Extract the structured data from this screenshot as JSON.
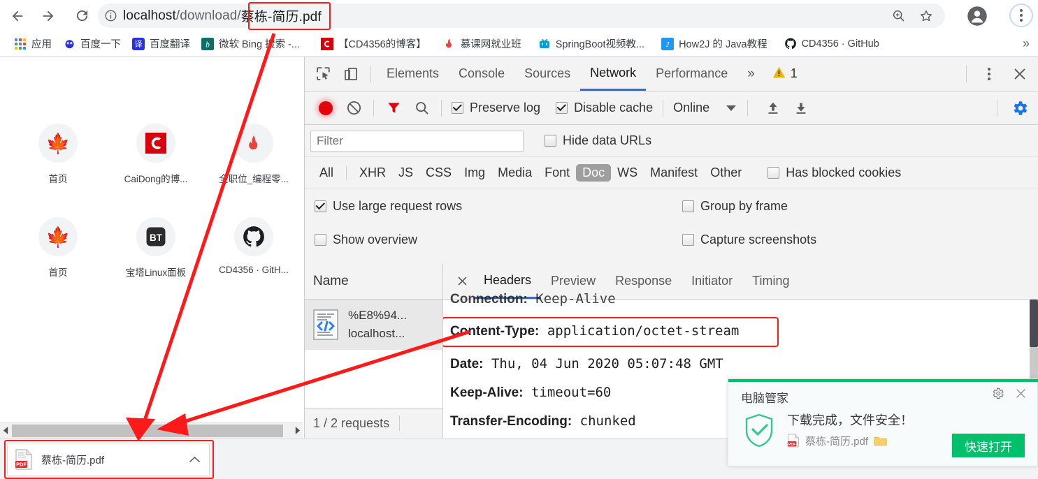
{
  "browser": {
    "nav": {
      "back": "back-arrow",
      "forward": "forward-arrow",
      "reload": "reload"
    },
    "omnibox": {
      "info_icon": "info-circle-icon",
      "url_host": "localhost",
      "url_path": "/download/",
      "url_file": "蔡栋-简历.pdf",
      "zoom_icon": "zoom-in-icon",
      "bookmark_icon": "star-icon"
    },
    "profile_icon": "account-avatar-icon",
    "menu_icon": "three-dot-menu-icon"
  },
  "bookmarks": {
    "overflow": "»",
    "items": [
      {
        "label": "应用",
        "icon": "apps-grid-icon"
      },
      {
        "label": "百度一下",
        "icon": "baidu-icon"
      },
      {
        "label": "百度翻译",
        "icon": "baidu-translate-icon"
      },
      {
        "label": "微软 Bing 搜索 -...",
        "icon": "bing-icon"
      },
      {
        "label": "【CD4356的博客】",
        "icon": "csdn-icon"
      },
      {
        "label": "慕课网就业班",
        "icon": "imooc-flame-icon"
      },
      {
        "label": "SpringBoot视频教...",
        "icon": "bilibili-icon"
      },
      {
        "label": "How2J 的 Java教程",
        "icon": "how2j-icon"
      },
      {
        "label": "CD4356 · GitHub",
        "icon": "github-icon"
      }
    ]
  },
  "newtab": {
    "shortcuts": [
      {
        "label": "首页",
        "icon": "maple-leaf-icon"
      },
      {
        "label": "CaiDong的博...",
        "icon": "csdn-c-icon"
      },
      {
        "label": "全职位_编程零...",
        "icon": "flame-icon"
      },
      {
        "label": "首页",
        "icon": "maple-leaf-icon"
      },
      {
        "label": "宝塔Linux面板",
        "icon": "bt-panel-icon"
      },
      {
        "label": "CD4356 · GitH...",
        "icon": "github-icon"
      }
    ],
    "hscroll": {
      "left_arrow": "scroll-left-arrow",
      "right_arrow": "scroll-right-arrow"
    }
  },
  "download_shelf": {
    "filename": "蔡栋-简历.pdf",
    "file_icon": "pdf-file-icon",
    "caret": "chevron-up-icon"
  },
  "devtools": {
    "inspect_icon": "inspect-element-icon",
    "device_icon": "device-toolbar-icon",
    "tabs": [
      {
        "label": "Elements",
        "active": false
      },
      {
        "label": "Console",
        "active": false
      },
      {
        "label": "Sources",
        "active": false
      },
      {
        "label": "Network",
        "active": true
      },
      {
        "label": "Performance",
        "active": false
      }
    ],
    "more_tabs": "»",
    "warning_icon": "warning-triangle-icon",
    "warning_count": "1",
    "settings_menu_icon": "three-dot-menu-icon",
    "close_icon": "close-x-icon",
    "toolbar": {
      "record_icon": "record-red-dot-icon",
      "clear_icon": "clear-no-entry-icon",
      "filter_icon": "funnel-filter-icon",
      "search_icon": "search-magnifier-icon",
      "preserve_log": {
        "label": "Preserve log",
        "checked": true
      },
      "disable_cache": {
        "label": "Disable cache",
        "checked": true
      },
      "throttling": "Online",
      "throttling_caret": "chevron-down-icon",
      "import_icon": "upload-arrow-icon",
      "export_icon": "download-arrow-icon",
      "gear_icon": "gear-settings-icon"
    },
    "filter": {
      "placeholder": "Filter",
      "value": "",
      "hide_data_urls": {
        "label": "Hide data URLs",
        "checked": false
      }
    },
    "types": [
      "All",
      "XHR",
      "JS",
      "CSS",
      "Img",
      "Media",
      "Font",
      "Doc",
      "WS",
      "Manifest",
      "Other"
    ],
    "types_selected": "Doc",
    "has_blocked_cookies": {
      "label": "Has blocked cookies",
      "checked": false
    },
    "options": [
      {
        "label": "Use large request rows",
        "checked": true
      },
      {
        "label": "Group by frame",
        "checked": false
      },
      {
        "label": "Show overview",
        "checked": false
      },
      {
        "label": "Capture screenshots",
        "checked": false
      }
    ],
    "requests": {
      "column_header": "Name",
      "rows": [
        {
          "name": "%E8%94...",
          "domain": "localhost...",
          "icon": "document-code-icon"
        }
      ],
      "footer": "1 / 2 requests"
    },
    "detail": {
      "close_icon": "close-x-icon",
      "tabs": [
        {
          "label": "Headers",
          "active": true
        },
        {
          "label": "Preview",
          "active": false
        },
        {
          "label": "Response",
          "active": false
        },
        {
          "label": "Initiator",
          "active": false
        },
        {
          "label": "Timing",
          "active": false
        }
      ],
      "headers": [
        {
          "name": "Connection:",
          "value": "Keep-Alive",
          "cut": true
        },
        {
          "name": "Content-Type:",
          "value": "application/octet-stream",
          "highlighted": true
        },
        {
          "name": "Date:",
          "value": "Thu, 04 Jun 2020 05:07:48 GMT"
        },
        {
          "name": "Keep-Alive:",
          "value": "timeout=60"
        },
        {
          "name": "Transfer-Encoding:",
          "value": "chunked"
        }
      ]
    }
  },
  "toast": {
    "title": "电脑管家",
    "gear_icon": "gear-settings-icon",
    "close_icon": "close-x-icon",
    "shield_icon": "shield-check-icon",
    "message": "下载完成，文件安全！",
    "file_icon": "pdf-file-icon",
    "filename": "蔡栋-简历.pdf",
    "folder_icon": "folder-icon",
    "button": "快速打开"
  },
  "colors": {
    "accent_blue": "#1a73e8",
    "record_red": "#e3000b",
    "annotation_red": "#ff1a1a",
    "toast_green": "#00c06a",
    "warning_yellow": "#f5b300"
  }
}
